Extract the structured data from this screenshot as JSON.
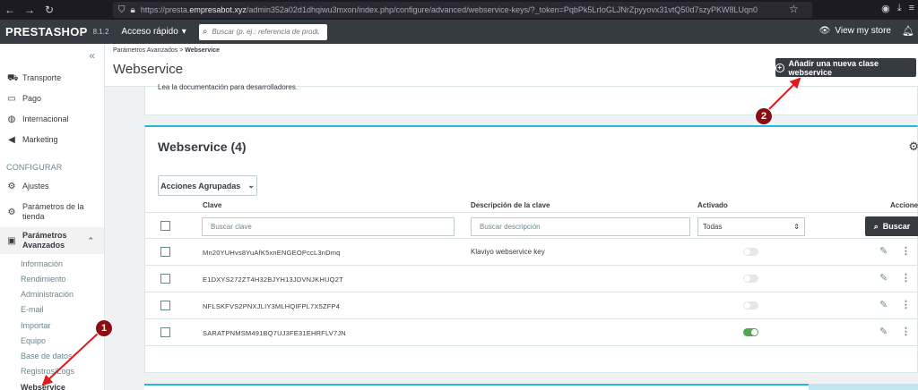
{
  "browser": {
    "url_prefix": "https://presta.",
    "url_domain": "empresabot.xyz",
    "url_rest": "/admin352a02d1dhqiwu3mxon/index.php/configure/advanced/webservice-keys/?_token=PqbPk5LrIoGLJNrZpyyovx31vtQ50d7szyPKW8LUqn0"
  },
  "header": {
    "logo": "PRESTASHOP",
    "version": "8.1.2",
    "quick_access": "Acceso rápido",
    "search_placeholder": "Buscar (p. ej.: referencia de products",
    "view_store": "View my store"
  },
  "sidebar": {
    "items": [
      {
        "label": "Transporte",
        "icon": "truck-icon"
      },
      {
        "label": "Pago",
        "icon": "card-icon"
      },
      {
        "label": "Internacional",
        "icon": "globe-icon"
      },
      {
        "label": "Marketing",
        "icon": "megaphone-icon"
      }
    ],
    "section": "CONFIGURAR",
    "config_items": [
      {
        "label": "Ajustes",
        "icon": "gear-icon"
      },
      {
        "label": "Parámetros de la",
        "label2": "tienda",
        "icon": "gear-icon"
      },
      {
        "label": "Parámetros",
        "label2": "Avanzados",
        "icon": "chip-icon"
      }
    ],
    "sub_items": [
      "Información",
      "Rendimiento",
      "Administración",
      "E-mail",
      "Importar",
      "Equipo",
      "Base de datos",
      "Registros/Logs",
      "Webservice"
    ]
  },
  "toolbar": {
    "breadcrumb_parent": "Parámetros Avanzados",
    "breadcrumb_current": "Webservice",
    "title": "Webservice",
    "add_button": "Añadir una nueva clase webservice"
  },
  "doc_text": "Lea la documentación para desarrolladores.",
  "table": {
    "title": "Webservice (4)",
    "bulk_actions": "Acciones Agrupadas",
    "columns": {
      "key": "Clave",
      "description": "Descripción de la clave",
      "active": "Activado",
      "actions": "Acciones"
    },
    "filters": {
      "key_placeholder": "Buscar clave",
      "desc_placeholder": "Buscar descripción",
      "active_value": "Todas",
      "search_button": "Buscar"
    },
    "rows": [
      {
        "key": "Mn20YUHvs8YuAfK5xnENGEOPccL3nDmq",
        "description": "Klaviyo webservice key",
        "active": false
      },
      {
        "key": "E1DXYS272ZT4H32BJYH13JDVNJKHUQ2T",
        "description": "",
        "active": false
      },
      {
        "key": "NFLSKFVS2PNXJLIY3MLHQIFPL7X5ZFP4",
        "description": "",
        "active": false
      },
      {
        "key": "SARATPNMSM491BQ7UJ3FE31EHRFLV7JN",
        "description": "",
        "active": true
      }
    ]
  },
  "annotations": {
    "marker1": "1",
    "marker2": "2"
  },
  "colors": {
    "accent": "#25b9d7",
    "dark": "#363a41",
    "toggle_on": "#4fa84a",
    "marker": "#8b0d12",
    "arrow": "#e0191b"
  }
}
